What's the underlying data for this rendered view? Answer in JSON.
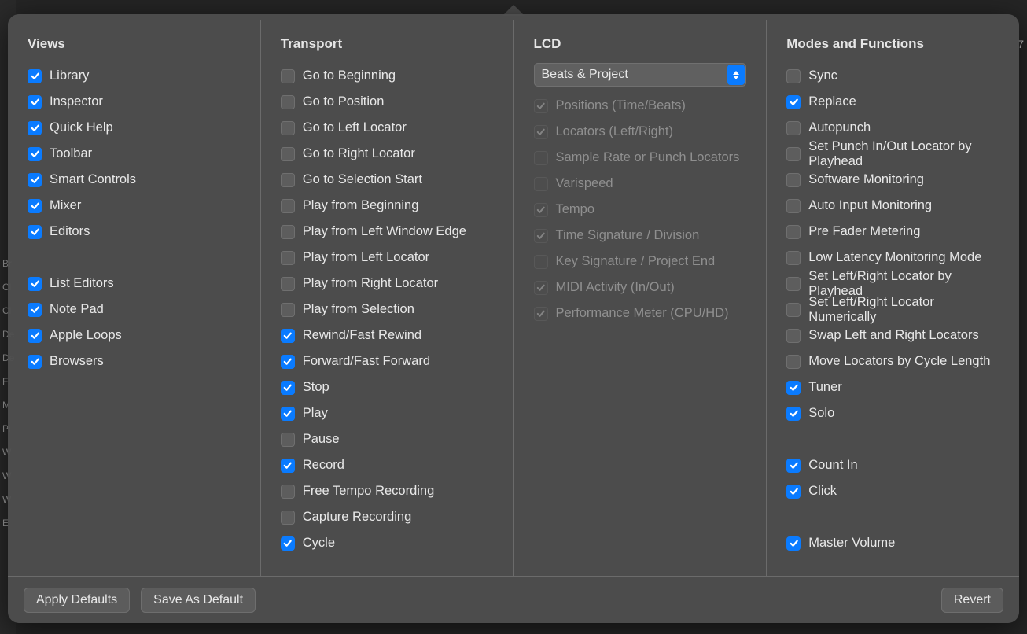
{
  "bg_labels": [
    "Br",
    "Cl",
    "Cl",
    "De",
    "De",
    "Fl",
    "M",
    "Pi",
    "W",
    "W",
    "W",
    "E"
  ],
  "bg_number": "7",
  "headers": {
    "views": "Views",
    "transport": "Transport",
    "lcd": "LCD",
    "modes": "Modes and Functions"
  },
  "views": [
    {
      "label": "Library",
      "checked": true
    },
    {
      "label": "Inspector",
      "checked": true
    },
    {
      "label": "Quick Help",
      "checked": true
    },
    {
      "label": "Toolbar",
      "checked": true
    },
    {
      "label": "Smart Controls",
      "checked": true
    },
    {
      "label": "Mixer",
      "checked": true
    },
    {
      "label": "Editors",
      "checked": true
    }
  ],
  "views2": [
    {
      "label": "List Editors",
      "checked": true
    },
    {
      "label": "Note Pad",
      "checked": true
    },
    {
      "label": "Apple Loops",
      "checked": true
    },
    {
      "label": "Browsers",
      "checked": true
    }
  ],
  "transport": [
    {
      "label": "Go to Beginning",
      "checked": false
    },
    {
      "label": "Go to Position",
      "checked": false
    },
    {
      "label": "Go to Left Locator",
      "checked": false
    },
    {
      "label": "Go to Right Locator",
      "checked": false
    },
    {
      "label": "Go to Selection Start",
      "checked": false
    },
    {
      "label": "Play from Beginning",
      "checked": false
    },
    {
      "label": "Play from Left Window Edge",
      "checked": false
    },
    {
      "label": "Play from Left Locator",
      "checked": false
    },
    {
      "label": "Play from Right Locator",
      "checked": false
    },
    {
      "label": "Play from Selection",
      "checked": false
    },
    {
      "label": "Rewind/Fast Rewind",
      "checked": true
    },
    {
      "label": "Forward/Fast Forward",
      "checked": true
    },
    {
      "label": "Stop",
      "checked": true
    },
    {
      "label": "Play",
      "checked": true
    },
    {
      "label": "Pause",
      "checked": false
    },
    {
      "label": "Record",
      "checked": true
    },
    {
      "label": "Free Tempo Recording",
      "checked": false
    },
    {
      "label": "Capture Recording",
      "checked": false
    },
    {
      "label": "Cycle",
      "checked": true
    }
  ],
  "lcd_select": "Beats & Project",
  "lcd": [
    {
      "label": "Positions (Time/Beats)",
      "checked": true,
      "disabled": true
    },
    {
      "label": "Locators (Left/Right)",
      "checked": true,
      "disabled": true
    },
    {
      "label": "Sample Rate or Punch Locators",
      "checked": false,
      "disabled": true
    },
    {
      "label": "Varispeed",
      "checked": false,
      "disabled": true
    },
    {
      "label": "Tempo",
      "checked": true,
      "disabled": true
    },
    {
      "label": "Time Signature / Division",
      "checked": true,
      "disabled": true
    },
    {
      "label": "Key Signature / Project End",
      "checked": false,
      "disabled": true
    },
    {
      "label": "MIDI Activity (In/Out)",
      "checked": true,
      "disabled": true
    },
    {
      "label": "Performance Meter (CPU/HD)",
      "checked": true,
      "disabled": true
    }
  ],
  "modes1": [
    {
      "label": "Sync",
      "checked": false
    },
    {
      "label": "Replace",
      "checked": true
    },
    {
      "label": "Autopunch",
      "checked": false
    },
    {
      "label": "Set Punch In/Out Locator by Playhead",
      "checked": false
    },
    {
      "label": "Software Monitoring",
      "checked": false
    },
    {
      "label": "Auto Input Monitoring",
      "checked": false
    },
    {
      "label": "Pre Fader Metering",
      "checked": false
    },
    {
      "label": "Low Latency Monitoring Mode",
      "checked": false
    },
    {
      "label": "Set Left/Right Locator by Playhead",
      "checked": false
    },
    {
      "label": "Set Left/Right Locator Numerically",
      "checked": false
    },
    {
      "label": "Swap Left and Right Locators",
      "checked": false
    },
    {
      "label": "Move Locators by Cycle Length",
      "checked": false
    },
    {
      "label": "Tuner",
      "checked": true
    },
    {
      "label": "Solo",
      "checked": true
    }
  ],
  "modes2": [
    {
      "label": "Count In",
      "checked": true
    },
    {
      "label": "Click",
      "checked": true
    }
  ],
  "modes3": [
    {
      "label": "Master Volume",
      "checked": true
    }
  ],
  "buttons": {
    "apply_defaults": "Apply Defaults",
    "save_as_default": "Save As Default",
    "revert": "Revert"
  }
}
